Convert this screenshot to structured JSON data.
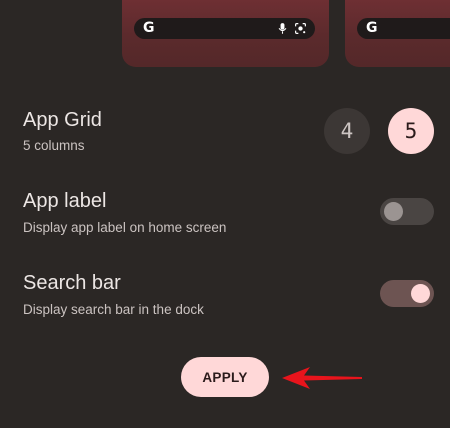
{
  "preview": {
    "search_g_glyph": "G",
    "icons": [
      "google-g-icon",
      "mic-icon",
      "lens-icon"
    ]
  },
  "app_grid": {
    "title": "App Grid",
    "subtitle": "5 columns",
    "options": [
      "4",
      "5"
    ],
    "selected": "5"
  },
  "app_label": {
    "title": "App label",
    "subtitle": "Display app label on home screen",
    "enabled": false
  },
  "search_bar": {
    "title": "Search bar",
    "subtitle": "Display search bar in the dock",
    "enabled": true
  },
  "apply_label": "APPLY",
  "colors": {
    "background": "#2b2725",
    "accent": "#ffd8d8",
    "annotation_arrow": "#e8141c"
  }
}
